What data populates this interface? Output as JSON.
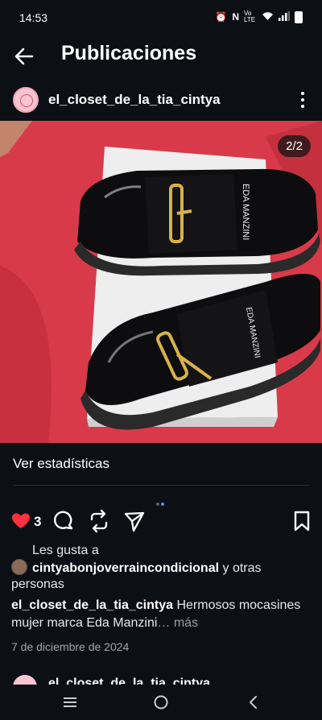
{
  "status_bar": {
    "time": "14:53",
    "network_label": "Vo LTE"
  },
  "header": {
    "title": "Publicaciones"
  },
  "post": {
    "username": "el_closet_de_la_tia_cintya",
    "image_counter": "2/2",
    "image_alt_brand": "EDA MANZINI",
    "stats_label": "Ver estadísticas",
    "like_count": "3",
    "likes_prefix": "Les gusta a",
    "liked_by": "cintyabonjoverraincondicional",
    "likes_suffix": "y otras personas",
    "caption_text": "Hermosos mocasines mujer marca Eda Manzini",
    "caption_more": "… más",
    "date": "7 de diciembre de 2024"
  },
  "next_post": {
    "username": "el_closet_de_la_tia_cintya"
  },
  "colors": {
    "background": "#0c0f14",
    "like_red": "#ff3040",
    "dot_active": "#4c8dff",
    "photo_bg": "#d93a4a"
  },
  "icons": [
    "back-arrow-icon",
    "more-options-icon",
    "heart-icon",
    "comment-icon",
    "repost-icon",
    "share-icon",
    "save-icon",
    "nav-recents-icon",
    "nav-home-icon",
    "nav-back-icon"
  ]
}
